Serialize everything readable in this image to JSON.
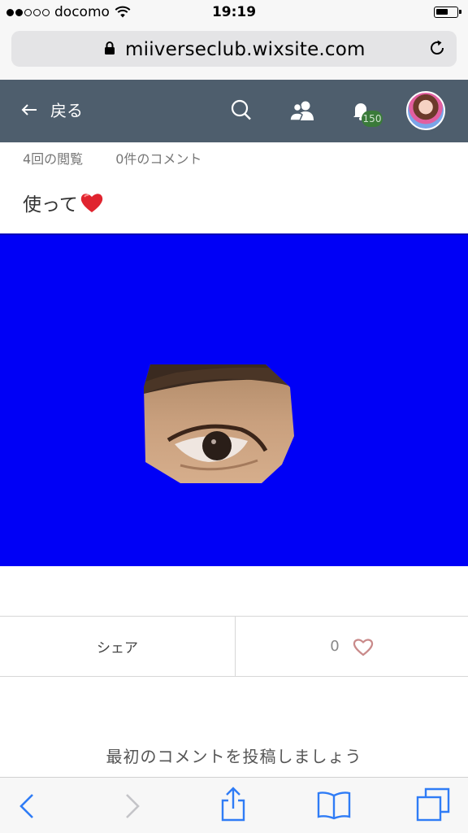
{
  "status_bar": {
    "carrier": "docomo",
    "time": "19:19",
    "signal_bars_filled": 2,
    "signal_bars_total": 5,
    "icons": [
      "signal-dots-icon",
      "wifi-icon",
      "battery-icon"
    ]
  },
  "browser": {
    "url": "miiverseclub.wixsite.com",
    "icons": [
      "lock-icon",
      "reload-icon"
    ]
  },
  "header": {
    "back_label": "戻る",
    "notification_count": "150",
    "icons": [
      "back-arrow-icon",
      "search-icon",
      "people-icon",
      "bell-icon",
      "avatar"
    ]
  },
  "post": {
    "views": "4回の閲覧",
    "comments": "0件のコメント",
    "text": "使って",
    "emoji_icon": "red-heart-emoji-icon",
    "image_background": "#0000f6"
  },
  "actions": {
    "share_label": "シェア",
    "like_count": "0",
    "icons": [
      "heart-outline-icon"
    ]
  },
  "comments": {
    "prompt": "最初のコメントを投稿しましょう"
  },
  "toolbar": {
    "icons": [
      "back-chevron-icon",
      "forward-chevron-icon",
      "share-icon",
      "bookmarks-icon",
      "tabs-icon"
    ]
  },
  "colors": {
    "header_bg": "#4e5e6d",
    "ios_blue": "#2f7cf6",
    "like_heart": "#c98a8a",
    "image_bg": "#0000f6"
  }
}
